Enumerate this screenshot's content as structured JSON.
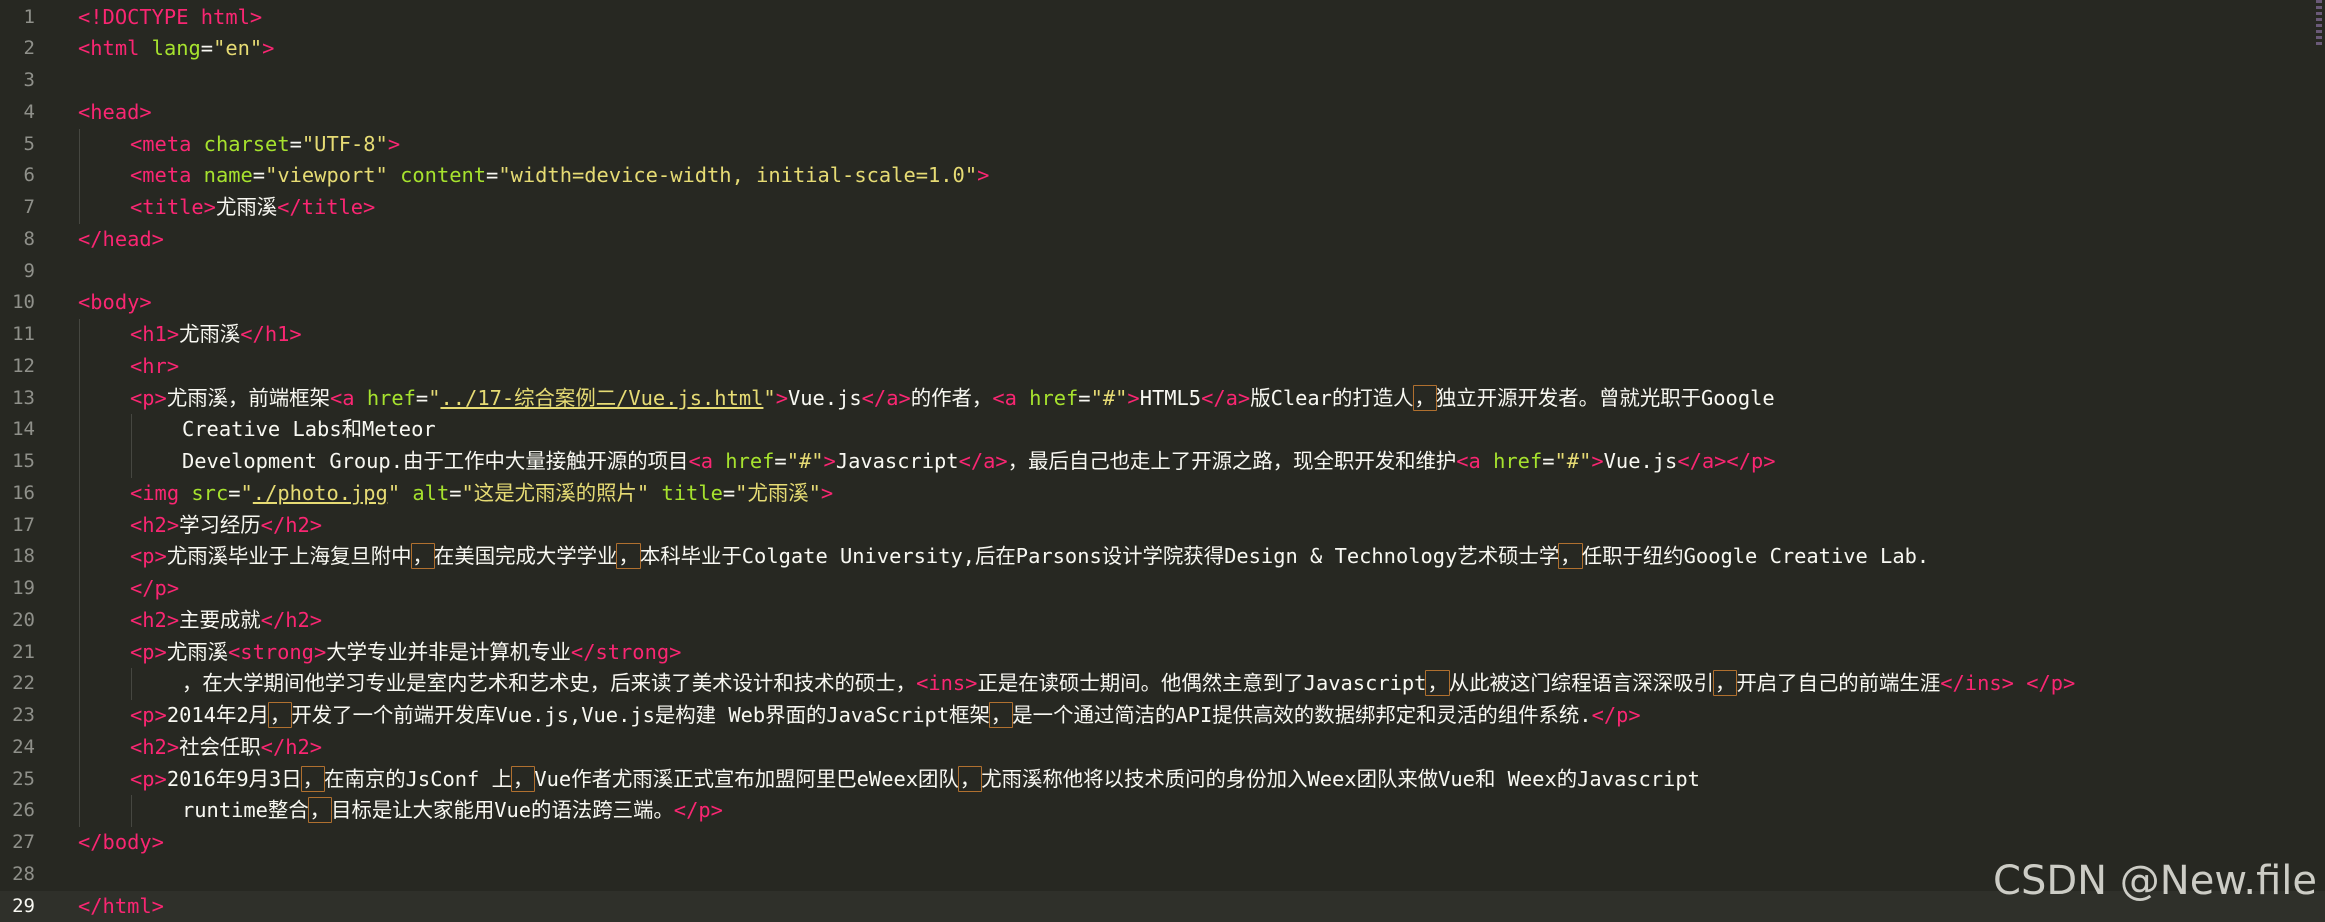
{
  "editor": {
    "current_line": 29,
    "lines": [
      {
        "n": "1",
        "indent": 0,
        "segs": [
          [
            "t",
            "<!DOCTYPE html>"
          ]
        ]
      },
      {
        "n": "2",
        "indent": 0,
        "segs": [
          [
            "t",
            "<html"
          ],
          [
            "p",
            " "
          ],
          [
            "a",
            "lang"
          ],
          [
            "p",
            "="
          ],
          [
            "s",
            "\"en\""
          ],
          [
            "t",
            ">"
          ]
        ]
      },
      {
        "n": "3",
        "indent": 0,
        "segs": []
      },
      {
        "n": "4",
        "indent": 0,
        "segs": [
          [
            "t",
            "<head>"
          ]
        ]
      },
      {
        "n": "5",
        "indent": 1,
        "segs": [
          [
            "t",
            "<meta"
          ],
          [
            "p",
            " "
          ],
          [
            "a",
            "charset"
          ],
          [
            "p",
            "="
          ],
          [
            "s",
            "\"UTF-8\""
          ],
          [
            "t",
            ">"
          ]
        ]
      },
      {
        "n": "6",
        "indent": 1,
        "segs": [
          [
            "t",
            "<meta"
          ],
          [
            "p",
            " "
          ],
          [
            "a",
            "name"
          ],
          [
            "p",
            "="
          ],
          [
            "s",
            "\"viewport\""
          ],
          [
            "p",
            " "
          ],
          [
            "a",
            "content"
          ],
          [
            "p",
            "="
          ],
          [
            "s",
            "\"width=device-width, initial-scale=1.0\""
          ],
          [
            "t",
            ">"
          ]
        ]
      },
      {
        "n": "7",
        "indent": 1,
        "segs": [
          [
            "t",
            "<title>"
          ],
          [
            "p",
            "尤雨溪"
          ],
          [
            "t",
            "</title>"
          ]
        ]
      },
      {
        "n": "8",
        "indent": 0,
        "segs": [
          [
            "t",
            "</head>"
          ]
        ]
      },
      {
        "n": "9",
        "indent": 0,
        "segs": []
      },
      {
        "n": "10",
        "indent": 0,
        "segs": [
          [
            "t",
            "<body>"
          ]
        ]
      },
      {
        "n": "11",
        "indent": 1,
        "segs": [
          [
            "t",
            "<h1>"
          ],
          [
            "p",
            "尤雨溪"
          ],
          [
            "t",
            "</h1>"
          ]
        ]
      },
      {
        "n": "12",
        "indent": 1,
        "segs": [
          [
            "t",
            "<hr>"
          ]
        ]
      },
      {
        "n": "13",
        "indent": 1,
        "segs": [
          [
            "t",
            "<p>"
          ],
          [
            "p",
            "尤雨溪，前端框架"
          ],
          [
            "t",
            "<a"
          ],
          [
            "p",
            " "
          ],
          [
            "a",
            "href"
          ],
          [
            "p",
            "="
          ],
          [
            "s",
            "\""
          ],
          [
            "u",
            "../17-综合案例二/Vue.js.html"
          ],
          [
            "s",
            "\""
          ],
          [
            "t",
            ">"
          ],
          [
            "p",
            "Vue.js"
          ],
          [
            "t",
            "</a>"
          ],
          [
            "p",
            "的作者，"
          ],
          [
            "t",
            "<a"
          ],
          [
            "p",
            " "
          ],
          [
            "a",
            "href"
          ],
          [
            "p",
            "="
          ],
          [
            "s",
            "\"#\""
          ],
          [
            "t",
            ">"
          ],
          [
            "p",
            "HTML5"
          ],
          [
            "t",
            "</a>"
          ],
          [
            "p",
            "版Clear的打造人"
          ],
          [
            "z",
            "，"
          ],
          [
            "p",
            "独立开源开发者。曾就光职于Google"
          ]
        ]
      },
      {
        "n": "14",
        "indent": 2,
        "segs": [
          [
            "p",
            "Creative Labs和Meteor"
          ]
        ]
      },
      {
        "n": "15",
        "indent": 2,
        "segs": [
          [
            "p",
            "Development Group.由于工作中大量接触开源的项目"
          ],
          [
            "t",
            "<a"
          ],
          [
            "p",
            " "
          ],
          [
            "a",
            "href"
          ],
          [
            "p",
            "="
          ],
          [
            "s",
            "\"#\""
          ],
          [
            "t",
            ">"
          ],
          [
            "p",
            "Javascript"
          ],
          [
            "t",
            "</a>"
          ],
          [
            "p",
            "，最后自己也走上了开源之路，现全职开发和维护"
          ],
          [
            "t",
            "<a"
          ],
          [
            "p",
            " "
          ],
          [
            "a",
            "href"
          ],
          [
            "p",
            "="
          ],
          [
            "s",
            "\"#\""
          ],
          [
            "t",
            ">"
          ],
          [
            "p",
            "Vue.js"
          ],
          [
            "t",
            "</a></p>"
          ]
        ]
      },
      {
        "n": "16",
        "indent": 1,
        "segs": [
          [
            "t",
            "<img"
          ],
          [
            "p",
            " "
          ],
          [
            "a",
            "src"
          ],
          [
            "p",
            "="
          ],
          [
            "s",
            "\""
          ],
          [
            "u",
            "./photo.jpg"
          ],
          [
            "s",
            "\""
          ],
          [
            "p",
            " "
          ],
          [
            "a",
            "alt"
          ],
          [
            "p",
            "="
          ],
          [
            "s",
            "\"这是尤雨溪的照片\""
          ],
          [
            "p",
            " "
          ],
          [
            "a",
            "title"
          ],
          [
            "p",
            "="
          ],
          [
            "s",
            "\"尤雨溪\""
          ],
          [
            "t",
            ">"
          ]
        ]
      },
      {
        "n": "17",
        "indent": 1,
        "segs": [
          [
            "t",
            "<h2>"
          ],
          [
            "p",
            "学习经历"
          ],
          [
            "t",
            "</h2>"
          ]
        ]
      },
      {
        "n": "18",
        "indent": 1,
        "segs": [
          [
            "t",
            "<p>"
          ],
          [
            "p",
            "尤雨溪毕业于上海复旦附中"
          ],
          [
            "z",
            "，"
          ],
          [
            "p",
            "在美国完成大学学业"
          ],
          [
            "z",
            "，"
          ],
          [
            "p",
            "本科毕业于Colgate University,后在Parsons设计学院获得Design & Technology艺术硕士学"
          ],
          [
            "z",
            "，"
          ],
          [
            "p",
            "任职于纽约Google Creative Lab."
          ]
        ]
      },
      {
        "n": "19",
        "indent": 1,
        "segs": [
          [
            "t",
            "</p>"
          ]
        ]
      },
      {
        "n": "20",
        "indent": 1,
        "segs": [
          [
            "t",
            "<h2>"
          ],
          [
            "p",
            "主要成就"
          ],
          [
            "t",
            "</h2>"
          ]
        ]
      },
      {
        "n": "21",
        "indent": 1,
        "segs": [
          [
            "t",
            "<p>"
          ],
          [
            "p",
            "尤雨溪"
          ],
          [
            "t",
            "<strong>"
          ],
          [
            "p",
            "大学专业并非是计算机专业"
          ],
          [
            "t",
            "</strong>"
          ]
        ]
      },
      {
        "n": "22",
        "indent": 2,
        "segs": [
          [
            "p",
            "，在大学期间他学习专业是室内艺术和艺术史，后来读了美术设计和技术的硕士，"
          ],
          [
            "t",
            "<ins>"
          ],
          [
            "p",
            "正是在读硕士期间。他偶然主意到了Javascript"
          ],
          [
            "z",
            "，"
          ],
          [
            "p",
            "从此被这门综程语言深深吸引"
          ],
          [
            "z",
            "，"
          ],
          [
            "p",
            "开启了自己的前端生涯"
          ],
          [
            "t",
            "</ins>"
          ],
          [
            "p",
            " "
          ],
          [
            "t",
            "</p>"
          ]
        ]
      },
      {
        "n": "23",
        "indent": 1,
        "segs": [
          [
            "t",
            "<p>"
          ],
          [
            "p",
            "2014年2月"
          ],
          [
            "z",
            "，"
          ],
          [
            "p",
            "开发了一个前端开发库Vue.js,Vue.js是构建 Web界面的JavaScript框架"
          ],
          [
            "z",
            "，"
          ],
          [
            "p",
            "是一个通过简洁的API提供高效的数据绑邦定和灵活的组件系统."
          ],
          [
            "t",
            "</p>"
          ]
        ]
      },
      {
        "n": "24",
        "indent": 1,
        "segs": [
          [
            "t",
            "<h2>"
          ],
          [
            "p",
            "社会任职"
          ],
          [
            "t",
            "</h2>"
          ]
        ]
      },
      {
        "n": "25",
        "indent": 1,
        "segs": [
          [
            "t",
            "<p>"
          ],
          [
            "p",
            "2016年9月3日"
          ],
          [
            "z",
            "，"
          ],
          [
            "p",
            "在南京的JsConf 上"
          ],
          [
            "z",
            "，"
          ],
          [
            "p",
            "Vue作者尤雨溪正式宣布加盟阿里巴eWeex团队"
          ],
          [
            "z",
            "，"
          ],
          [
            "p",
            "尤雨溪称他将以技术质问的身份加入Weex团队来做Vue和 Weex的Javascript"
          ]
        ]
      },
      {
        "n": "26",
        "indent": 2,
        "segs": [
          [
            "p",
            "runtime整合"
          ],
          [
            "z",
            "，"
          ],
          [
            "p",
            "目标是让大家能用Vue的语法跨三端。"
          ],
          [
            "t",
            "</p>"
          ]
        ]
      },
      {
        "n": "27",
        "indent": 0,
        "segs": [
          [
            "t",
            "</body>"
          ]
        ]
      },
      {
        "n": "28",
        "indent": 0,
        "segs": []
      },
      {
        "n": "29",
        "indent": 0,
        "segs": [
          [
            "t",
            "</html>"
          ]
        ]
      }
    ]
  },
  "watermark": "CSDN @New.file",
  "colors": {
    "background": "#272822",
    "tag": "#f92672",
    "attribute": "#a6e22e",
    "string": "#e6db74",
    "text": "#f8f8f2",
    "line_number": "#8f908a"
  }
}
